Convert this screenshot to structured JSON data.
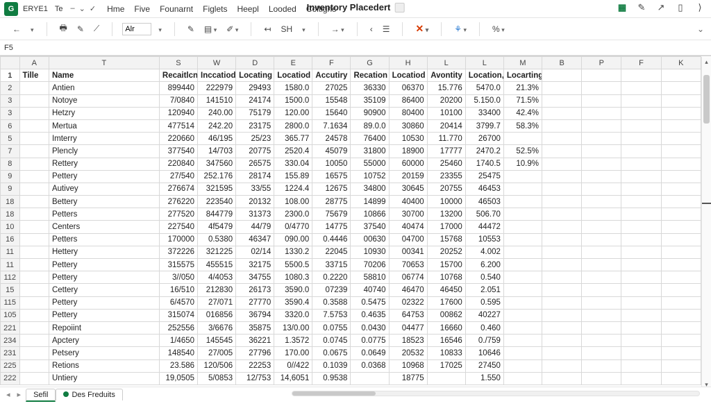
{
  "app": {
    "badge": "G",
    "quicklabel": "ERYE1",
    "ql2": "Te",
    "title": "Inventory Placedert"
  },
  "menu": [
    "Hme",
    "Five",
    "Founarnt",
    "Figlets",
    "Heepl",
    "Looded",
    "Coltigns"
  ],
  "toolbar": {
    "font_sample": "Alr",
    "sh_label": "SH"
  },
  "namebox": "F5",
  "columns": [
    "A",
    "T",
    "S",
    "W",
    "D",
    "E",
    "F",
    "G",
    "H",
    "L",
    "L",
    "M",
    "B",
    "P",
    "F",
    "K"
  ],
  "header_row": {
    "row_no": "1",
    "A": "Tille",
    "T": "Name",
    "S": "Recaitlcn",
    "W": "Inccatiod",
    "D": "Locating",
    "E": "Locatiod",
    "F": "Accutiry",
    "G": "Recation",
    "H": "Locatiod",
    "L1": "Avontity",
    "L2": "Location,",
    "M": "Locarting"
  },
  "rows": [
    {
      "n": "2",
      "T": "Antien",
      "S": "899440",
      "W": "222979",
      "D": "29493",
      "E": "1580.0",
      "F": "27025",
      "G": "36330",
      "H": "06370",
      "L1": "15.776",
      "L2": "5470.0",
      "M": "21.3%"
    },
    {
      "n": "3",
      "T": "Notoye",
      "S": "7/0840",
      "W": "141510",
      "D": "24174",
      "E": "1500.0",
      "F": "15548",
      "G": "35109",
      "H": "86400",
      "L1": "20200",
      "L2": "5.150.0",
      "M": "71.5%"
    },
    {
      "n": "3",
      "T": "Hetzry",
      "S": "120940",
      "W": "240.00",
      "D": "75179",
      "E": "120.00",
      "F": "15640",
      "G": "90900",
      "H": "80400",
      "L1": "10100",
      "L2": "33400",
      "M": "42.4%"
    },
    {
      "n": "6",
      "T": "Mertua",
      "S": "477514",
      "W": "242.20",
      "D": "23175",
      "E": "2800.0",
      "F": "7.1634",
      "G": "89.0.0",
      "H": "30860",
      "L1": "20414",
      "L2": "3799.7",
      "M": "58.3%"
    },
    {
      "n": "5",
      "T": "Imterry",
      "S": "220660",
      "W": "46/195",
      "D": "25/23",
      "E": "365.77",
      "F": "24578",
      "G": "76400",
      "H": "10530",
      "L1": "11.770",
      "L2": "26700",
      "M": ""
    },
    {
      "n": "7",
      "T": "Plencly",
      "S": "377540",
      "W": "14/703",
      "D": "20775",
      "E": "2520.4",
      "F": "45079",
      "G": "31800",
      "H": "18900",
      "L1": "17777",
      "L2": "2470.2",
      "M": "52.5%"
    },
    {
      "n": "8",
      "T": "Rettery",
      "S": "220840",
      "W": "347560",
      "D": "26575",
      "E": "330.04",
      "F": "10050",
      "G": "55000",
      "H": "60000",
      "L1": "25460",
      "L2": "1740.5",
      "M": "10.9%"
    },
    {
      "n": "9",
      "T": "Pettery",
      "S": "27/540",
      "W": "252.176",
      "D": "28174",
      "E": "155.89",
      "F": "16575",
      "G": "10752",
      "H": "20159",
      "L1": "23355",
      "L2": "25475",
      "M": ""
    },
    {
      "n": "9",
      "T": "Autivey",
      "S": "276674",
      "W": "321595",
      "D": "33/55",
      "E": "1224.4",
      "F": "12675",
      "G": "34800",
      "H": "30645",
      "L1": "20755",
      "L2": "46453",
      "M": ""
    },
    {
      "n": "18",
      "T": "Bettery",
      "S": "276220",
      "W": "223540",
      "D": "20132",
      "E": "108.00",
      "F": "28775",
      "G": "14899",
      "H": "40400",
      "L1": "10000",
      "L2": "46503",
      "M": ""
    },
    {
      "n": "18",
      "T": "Petters",
      "S": "277520",
      "W": "844779",
      "D": "31373",
      "E": "2300.0",
      "F": "75679",
      "G": "10866",
      "H": "30700",
      "L1": "13200",
      "L2": "506.70",
      "M": ""
    },
    {
      "n": "10",
      "T": "Centers",
      "S": "227540",
      "W": "4f5479",
      "D": "44/79",
      "E": "0/4770",
      "F": "14775",
      "G": "37540",
      "H": "40474",
      "L1": "17000",
      "L2": "44472",
      "M": ""
    },
    {
      "n": "16",
      "T": "Petters",
      "S": "170000",
      "W": "0.5380",
      "D": "46347",
      "E": "090.00",
      "F": "0.4446",
      "G": "00630",
      "H": "04700",
      "L1": "15768",
      "L2": "10553",
      "M": ""
    },
    {
      "n": "11",
      "T": "Hettery",
      "S": "372226",
      "W": "321225",
      "D": "02/14",
      "E": "1330.2",
      "F": "22045",
      "G": "10930",
      "H": "00341",
      "L1": "20252",
      "L2": "4.002",
      "M": ""
    },
    {
      "n": "11",
      "T": "Pettery",
      "S": "315575",
      "W": "455515",
      "D": "32175",
      "E": "5500.5",
      "F": "33715",
      "G": "70206",
      "H": "70653",
      "L1": "15700",
      "L2": "6.200",
      "M": ""
    },
    {
      "n": "112",
      "T": "Pettery",
      "S": "3//050",
      "W": "4/4053",
      "D": "34755",
      "E": "1080.3",
      "F": "0.2220",
      "G": "58810",
      "H": "06774",
      "L1": "10768",
      "L2": "0.540",
      "M": ""
    },
    {
      "n": "15",
      "T": "Cettery",
      "S": "16/510",
      "W": "212830",
      "D": "26173",
      "E": "3590.0",
      "F": "07239",
      "G": "40740",
      "H": "46470",
      "L1": "46450",
      "L2": "2.051",
      "M": ""
    },
    {
      "n": "115",
      "T": "Pettery",
      "S": "6/4570",
      "W": "27/071",
      "D": "27770",
      "E": "3590.4",
      "F": "0.3588",
      "G": "0.5475",
      "H": "02322",
      "L1": "17600",
      "L2": "0.595",
      "M": ""
    },
    {
      "n": "105",
      "T": "Pettery",
      "S": "315074",
      "W": "016856",
      "D": "36794",
      "E": "3320.0",
      "F": "7.5753",
      "G": "0.4635",
      "H": "64753",
      "L1": "00862",
      "L2": "40227",
      "M": ""
    },
    {
      "n": "221",
      "T": "Repoiint",
      "S": "252556",
      "W": "3/6676",
      "D": "35875",
      "E": "13/0.00",
      "F": "0.0755",
      "G": "0.0430",
      "H": "04477",
      "L1": "16660",
      "L2": "0.460",
      "M": ""
    },
    {
      "n": "234",
      "T": "Apctery",
      "S": "1/4650",
      "W": "145545",
      "D": "36221",
      "E": "1.3572",
      "F": "0.0745",
      "G": "0.0775",
      "H": "18523",
      "L1": "16546",
      "L2": "0./759",
      "M": ""
    },
    {
      "n": "231",
      "T": "Petsery",
      "S": "148540",
      "W": "27/005",
      "D": "27796",
      "E": "170.00",
      "F": "0.0675",
      "G": "0.0649",
      "H": "20532",
      "L1": "10833",
      "L2": "10646",
      "M": ""
    },
    {
      "n": "225",
      "T": "Retions",
      "S": "23.586",
      "W": "120/506",
      "D": "22253",
      "E": "0//422",
      "F": "0.1039",
      "G": "0.0368",
      "H": "10968",
      "L1": "17025",
      "L2": "27450",
      "M": ""
    },
    {
      "n": "222",
      "T": "Untiery",
      "S": "19,0505",
      "W": "5/0853",
      "D": "12/753",
      "E": "14,6051",
      "F": "0.9538",
      "G": "",
      "H": "18775",
      "L1": "",
      "L2": "1.550",
      "M": ""
    }
  ],
  "tabs": [
    {
      "label": "Sefil",
      "active": true,
      "dot": false
    },
    {
      "label": "Des Freduits",
      "active": false,
      "dot": true
    }
  ]
}
